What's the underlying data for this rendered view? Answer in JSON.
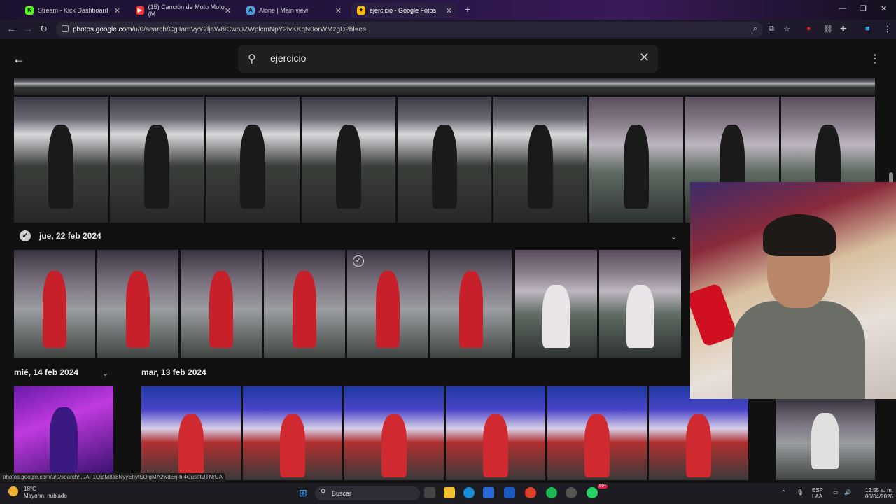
{
  "tabs": [
    {
      "label": "Stream - Kick Dashboard",
      "favicon": "K",
      "favicon_color": "#53fc18"
    },
    {
      "label": "(15) Canción de Moto Moto (M",
      "favicon": "▶",
      "favicon_color": "#ff3030"
    },
    {
      "label": "Alone | Main view",
      "favicon": "A",
      "favicon_color": "#4aa3df"
    },
    {
      "label": "ejercicio - Google Fotos",
      "favicon": "✦",
      "favicon_color": "#fbbc04"
    }
  ],
  "window_controls": {
    "minimize": "—",
    "restore": "❐",
    "close": "✕"
  },
  "address": {
    "host": "photos.google.com",
    "path": "/u/0/search/CglIamVyY2ljaW8iCwoJZWplcmNpY2lvKKqN0orWMzgD?hl=es"
  },
  "search": {
    "query": "ejercicio"
  },
  "sections": {
    "top_date": "jue, 22 feb 2024",
    "mid_left_date": "mié, 14 feb 2024",
    "mid_right_date": "mar, 13 feb 2024"
  },
  "status_url": "photos.google.com/u/0/search/.../AF1QipM8a8NyyEhytSOjgMA2wdErj-hl4CusotUTNrUA",
  "weather": {
    "temp": "18°C",
    "desc": "Mayorm. nublado"
  },
  "taskbar": {
    "search_label": "Buscar",
    "badge": "99+"
  },
  "tray": {
    "lang": "ESP",
    "region": "LAA",
    "time": "12:55 a. m.",
    "date": "06/04/2026"
  }
}
